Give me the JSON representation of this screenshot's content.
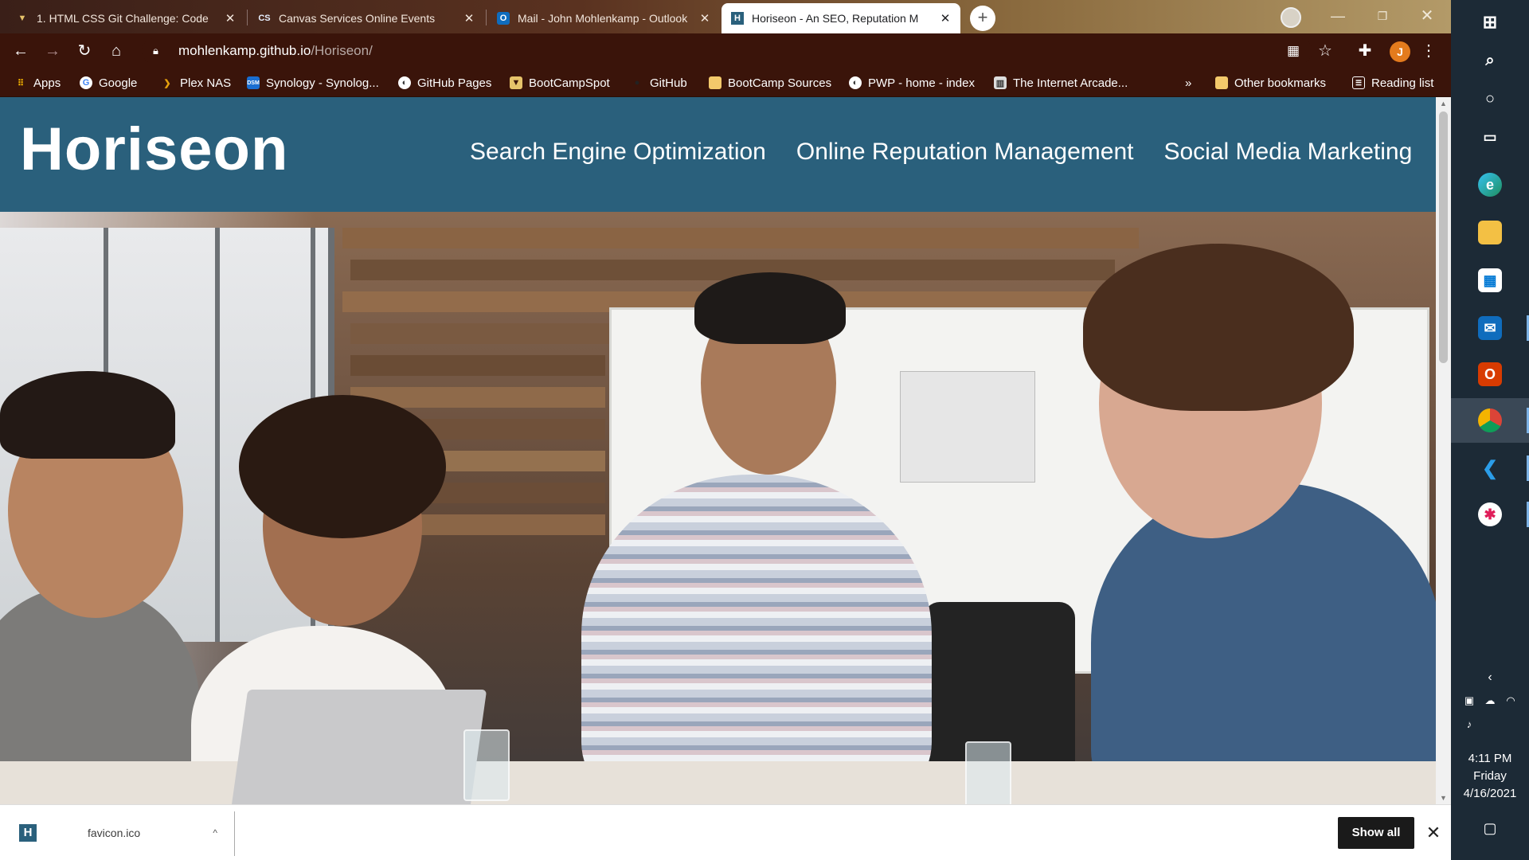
{
  "tabs": [
    {
      "title": "1. HTML CSS Git Challenge: Code",
      "icon": "v-shield"
    },
    {
      "title": "Canvas Services Online Events",
      "icon": "cs-logo"
    },
    {
      "title": "Mail - John Mohlenkamp - Outlook",
      "icon": "outlook"
    },
    {
      "title": "Horiseon - An SEO, Reputation M",
      "icon": "horiseon-h",
      "active": true
    }
  ],
  "toolbar": {
    "url_host": "mohlenkamp.github.io",
    "url_path": "/Horiseon/",
    "avatar_letter": "J"
  },
  "bookmarks": {
    "items": [
      {
        "label": "Apps"
      },
      {
        "label": "Google"
      },
      {
        "label": "Plex NAS"
      },
      {
        "label": "Synology - Synolog..."
      },
      {
        "label": "GitHub Pages"
      },
      {
        "label": "BootCampSpot"
      },
      {
        "label": "GitHub"
      },
      {
        "label": "BootCamp Sources"
      },
      {
        "label": "PWP - home - index"
      },
      {
        "label": "The Internet Arcade..."
      }
    ],
    "overflow": "»",
    "other": "Other bookmarks",
    "reading_list": "Reading list"
  },
  "site": {
    "logo": "Horiseon",
    "nav": [
      "Search Engine Optimization",
      "Online Reputation Management",
      "Social Media Marketing"
    ],
    "brand_color": "#2a607c"
  },
  "downloads": {
    "file_name": "favicon.ico",
    "caret": "^",
    "show_all": "Show all"
  },
  "taskbar": {
    "apps": [
      "windows-start",
      "search",
      "cortana",
      "task-view",
      "edge",
      "file-explorer",
      "store",
      "mail",
      "office",
      "chrome",
      "vscode",
      "slack"
    ],
    "time": "4:11 PM",
    "day": "Friday",
    "date": "4/16/2021"
  }
}
